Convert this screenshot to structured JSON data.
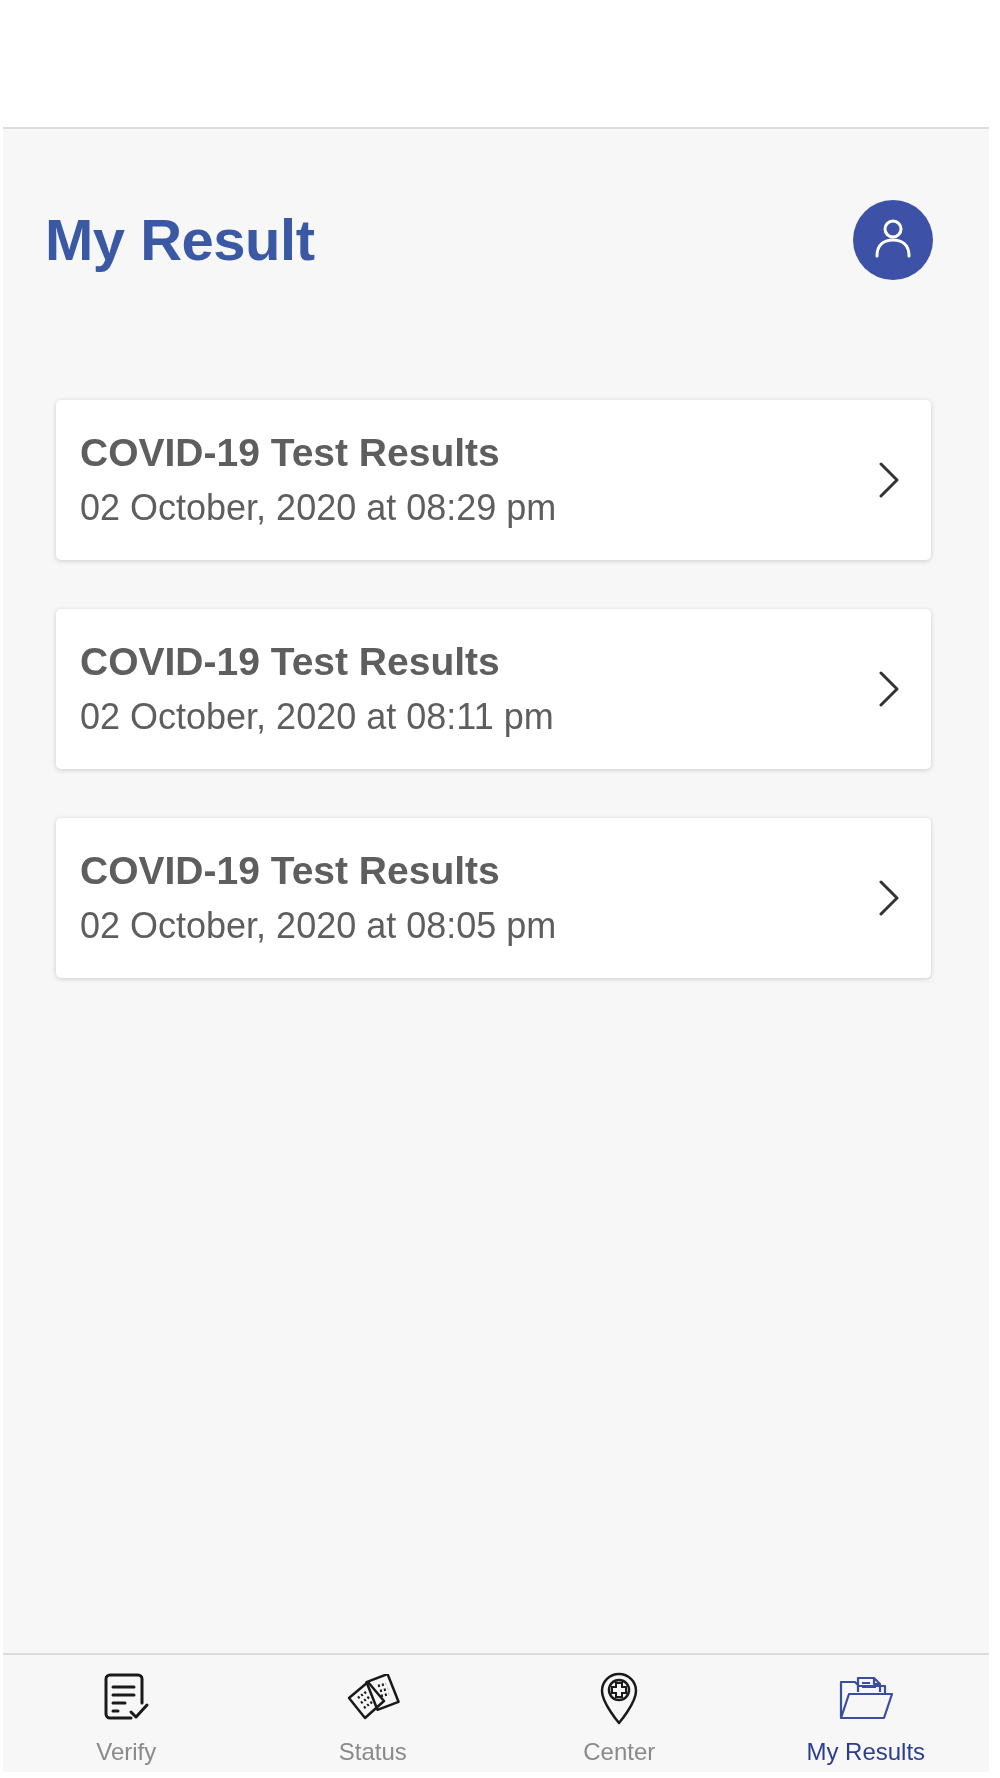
{
  "header": {
    "title": "My Result"
  },
  "results": [
    {
      "title": "COVID-19 Test Results",
      "date": "02 October, 2020 at 08:29 pm"
    },
    {
      "title": "COVID-19 Test Results",
      "date": "02 October, 2020 at 08:11 pm"
    },
    {
      "title": "COVID-19 Test Results",
      "date": "02 October, 2020 at 08:05 pm"
    }
  ],
  "tab_bar": {
    "tabs": [
      {
        "label": "Verify",
        "kind": "verify",
        "selected": false
      },
      {
        "label": "Status",
        "kind": "tickets",
        "selected": false
      },
      {
        "label": "Center",
        "kind": "pin",
        "selected": false
      },
      {
        "label": "My Results",
        "kind": "folder",
        "selected": true
      }
    ]
  }
}
